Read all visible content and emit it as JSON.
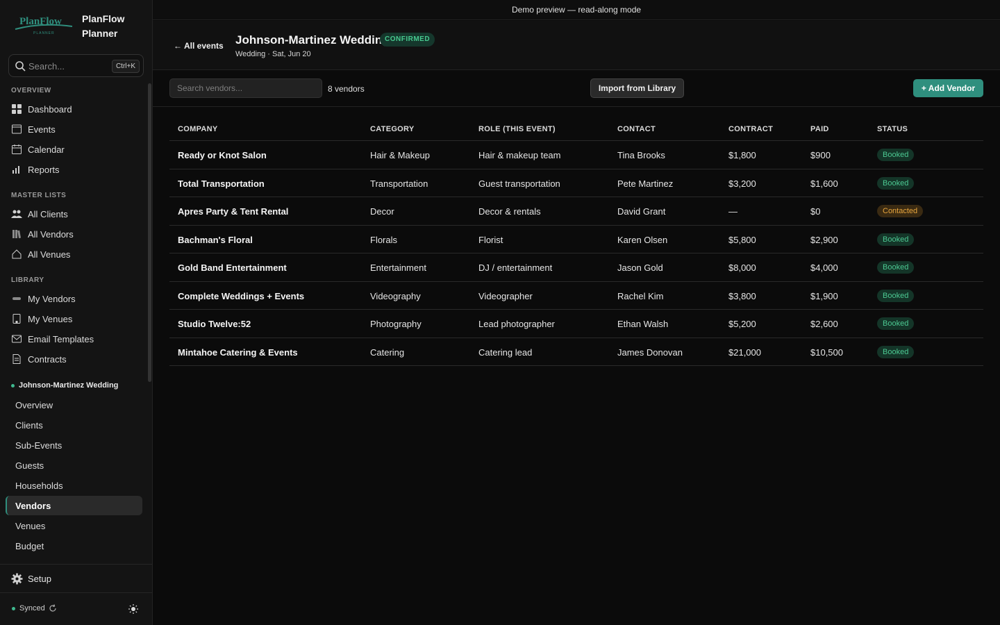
{
  "app": {
    "name": "PlanFlow Planner",
    "logo_text": "PlanFlow",
    "logo_sub": "PLANNER"
  },
  "banner": "Demo preview — read-along mode",
  "search": {
    "placeholder": "Search...",
    "shortcut": "Ctrl+K"
  },
  "sidebar": {
    "sections": [
      {
        "label": "OVERVIEW",
        "items": [
          {
            "label": "Dashboard",
            "icon": "grid-icon"
          },
          {
            "label": "Events",
            "icon": "list-icon"
          },
          {
            "label": "Calendar",
            "icon": "calendar-icon"
          },
          {
            "label": "Reports",
            "icon": "bar-chart-icon"
          }
        ]
      },
      {
        "label": "MASTER LISTS",
        "items": [
          {
            "label": "All Clients",
            "icon": "users-icon"
          },
          {
            "label": "All Vendors",
            "icon": "books-icon"
          },
          {
            "label": "All Venues",
            "icon": "home-icon"
          }
        ]
      },
      {
        "label": "LIBRARY",
        "items": [
          {
            "label": "My Vendors",
            "icon": "tag-icon"
          },
          {
            "label": "My Venues",
            "icon": "building-icon"
          },
          {
            "label": "Email Templates",
            "icon": "mail-icon"
          },
          {
            "label": "Contracts",
            "icon": "document-icon"
          }
        ]
      }
    ],
    "event": {
      "name": "Johnson-Martinez Wedding",
      "items": [
        "Overview",
        "Clients",
        "Sub-Events",
        "Guests",
        "Households",
        "Vendors",
        "Venues",
        "Budget"
      ],
      "active": "Vendors"
    },
    "setup_label": "Setup",
    "sync_status": "Synced"
  },
  "header": {
    "back_label": "All events",
    "title": "Johnson-Martinez Wedding",
    "status": "CONFIRMED",
    "subtitle": "Wedding · Sat, Jun 20"
  },
  "toolbar": {
    "search_placeholder": "Search vendors...",
    "count": "8 vendors",
    "import_label": "Import from Library",
    "add_label": "+ Add Vendor"
  },
  "table": {
    "columns": [
      "COMPANY",
      "CATEGORY",
      "ROLE (THIS EVENT)",
      "CONTACT",
      "CONTRACT",
      "PAID",
      "STATUS"
    ],
    "rows": [
      {
        "company": "Ready or Knot Salon",
        "category": "Hair & Makeup",
        "role": "Hair & makeup team",
        "contact": "Tina Brooks",
        "contract": "$1,800",
        "paid": "$900",
        "status": "Booked"
      },
      {
        "company": "Total Transportation",
        "category": "Transportation",
        "role": "Guest transportation",
        "contact": "Pete Martinez",
        "contract": "$3,200",
        "paid": "$1,600",
        "status": "Booked"
      },
      {
        "company": "Apres Party & Tent Rental",
        "category": "Decor",
        "role": "Decor & rentals",
        "contact": "David Grant",
        "contract": "—",
        "paid": "$0",
        "status": "Contacted"
      },
      {
        "company": "Bachman's Floral",
        "category": "Florals",
        "role": "Florist",
        "contact": "Karen Olsen",
        "contract": "$5,800",
        "paid": "$2,900",
        "status": "Booked"
      },
      {
        "company": "Gold Band Entertainment",
        "category": "Entertainment",
        "role": "DJ / entertainment",
        "contact": "Jason Gold",
        "contract": "$8,000",
        "paid": "$4,000",
        "status": "Booked"
      },
      {
        "company": "Complete Weddings + Events",
        "category": "Videography",
        "role": "Videographer",
        "contact": "Rachel Kim",
        "contract": "$3,800",
        "paid": "$1,900",
        "status": "Booked"
      },
      {
        "company": "Studio Twelve:52",
        "category": "Photography",
        "role": "Lead photographer",
        "contact": "Ethan Walsh",
        "contract": "$5,200",
        "paid": "$2,600",
        "status": "Booked"
      },
      {
        "company": "Mintahoe Catering & Events",
        "category": "Catering",
        "role": "Catering lead",
        "contact": "James Donovan",
        "contract": "$21,000",
        "paid": "$10,500",
        "status": "Booked"
      }
    ]
  }
}
